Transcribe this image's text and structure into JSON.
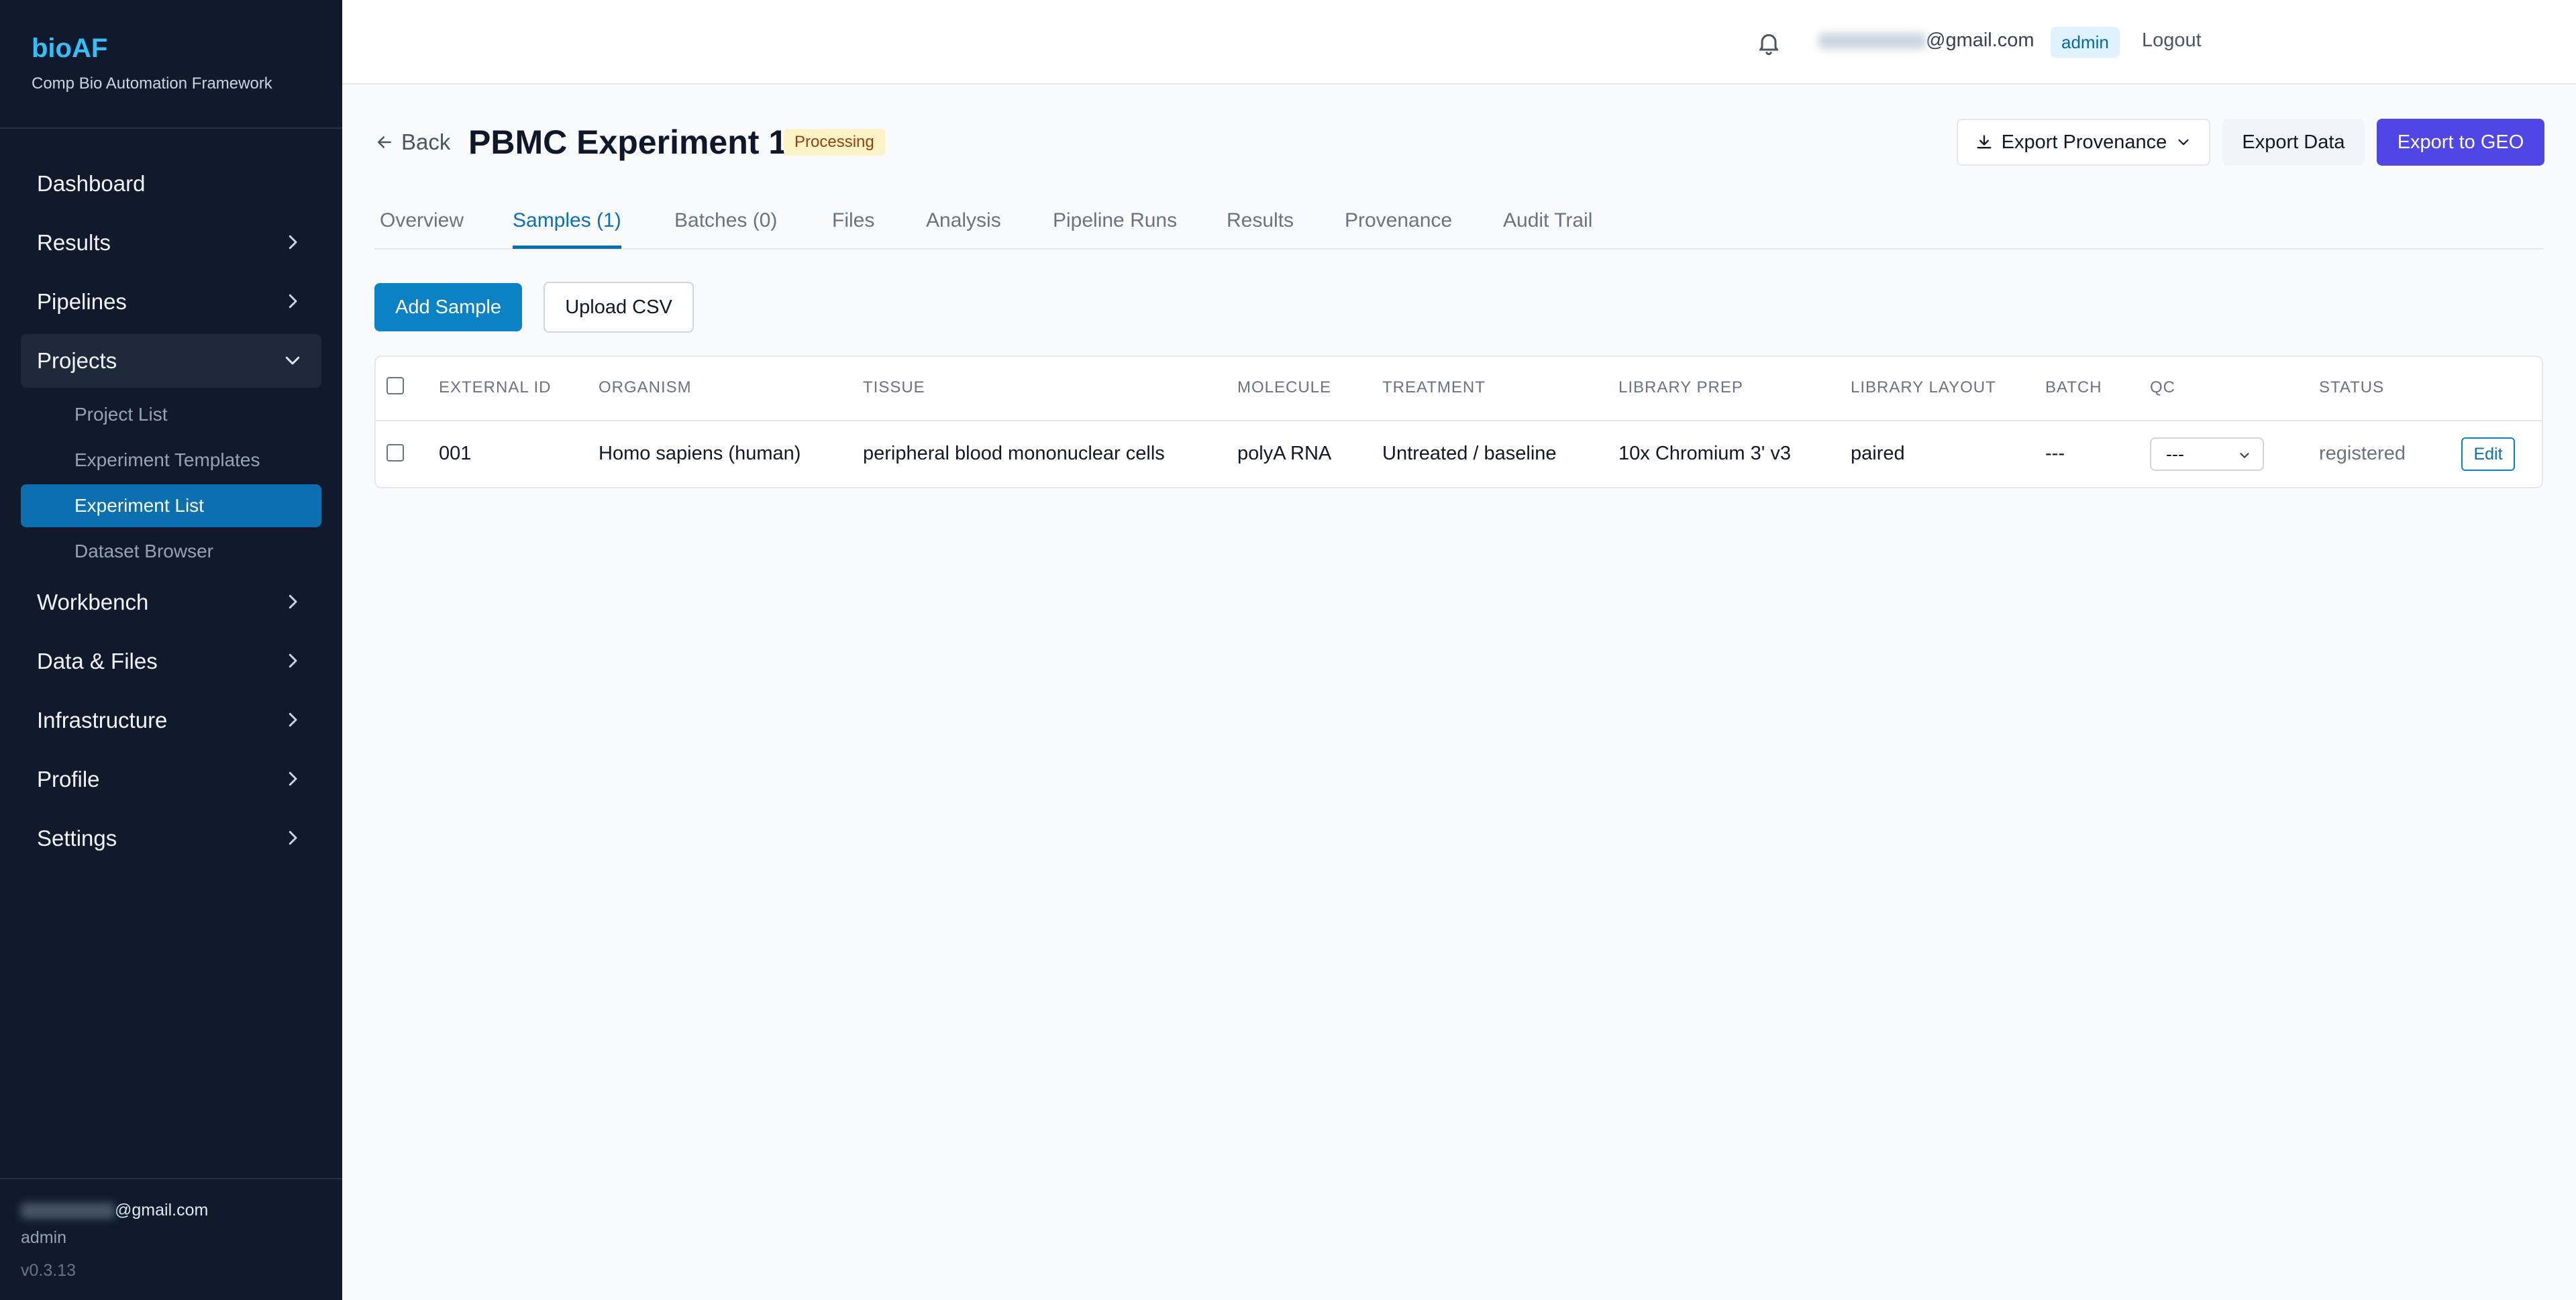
{
  "sidebar": {
    "brand_title": "bioAF",
    "brand_sub": "Comp Bio Automation Framework",
    "items": [
      {
        "label": "Dashboard"
      },
      {
        "label": "Results"
      },
      {
        "label": "Pipelines"
      },
      {
        "label": "Projects"
      },
      {
        "label": "Workbench"
      },
      {
        "label": "Data & Files"
      },
      {
        "label": "Infrastructure"
      },
      {
        "label": "Profile"
      },
      {
        "label": "Settings"
      }
    ],
    "projects_sub": [
      {
        "label": "Project List"
      },
      {
        "label": "Experiment Templates"
      },
      {
        "label": "Experiment List"
      },
      {
        "label": "Dataset Browser"
      }
    ],
    "footer": {
      "email_suffix": "@gmail.com",
      "role": "admin",
      "version": "v0.3.13"
    }
  },
  "topbar": {
    "email_suffix": "@gmail.com",
    "role": "admin",
    "logout": "Logout"
  },
  "header": {
    "back": "Back",
    "title": "PBMC Experiment 1",
    "status": "Processing",
    "export_provenance": "Export Provenance",
    "export_data": "Export Data",
    "export_geo": "Export to GEO"
  },
  "tabs": [
    {
      "label": "Overview"
    },
    {
      "label": "Samples (1)"
    },
    {
      "label": "Batches (0)"
    },
    {
      "label": "Files"
    },
    {
      "label": "Analysis"
    },
    {
      "label": "Pipeline Runs"
    },
    {
      "label": "Results"
    },
    {
      "label": "Provenance"
    },
    {
      "label": "Audit Trail"
    }
  ],
  "actions": {
    "add_sample": "Add Sample",
    "upload_csv": "Upload CSV"
  },
  "table": {
    "columns": [
      "EXTERNAL ID",
      "ORGANISM",
      "TISSUE",
      "MOLECULE",
      "TREATMENT",
      "LIBRARY PREP",
      "LIBRARY LAYOUT",
      "BATCH",
      "QC",
      "STATUS"
    ],
    "rows": [
      {
        "external_id": "001",
        "organism": "Homo sapiens (human)",
        "tissue": "peripheral blood mononuclear cells",
        "molecule": "polyA RNA",
        "treatment": "Untreated / baseline",
        "library_prep": "10x Chromium 3' v3",
        "library_layout": "paired",
        "batch": "---",
        "qc": "---",
        "status": "registered",
        "edit": "Edit"
      }
    ]
  }
}
